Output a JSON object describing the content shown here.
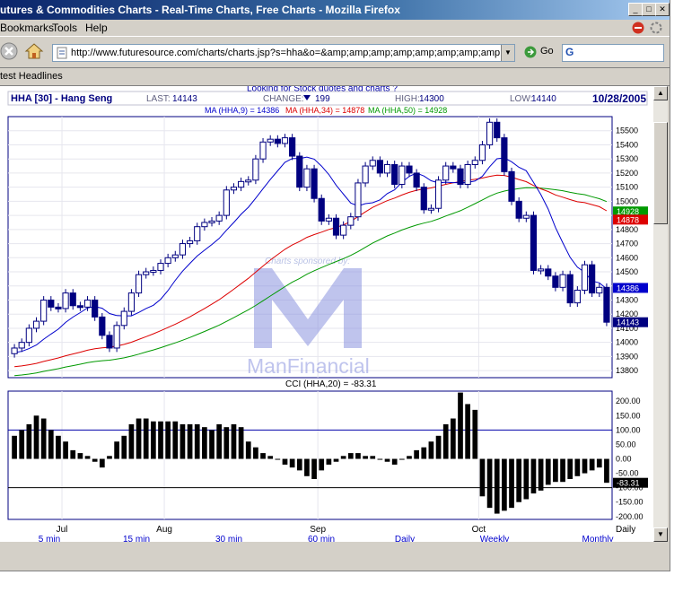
{
  "window": {
    "title": "utures & Commodities Charts - Real-Time Charts, Free Charts - Mozilla Firefox"
  },
  "menu": [
    "Bookmarks",
    "Tools",
    "Help"
  ],
  "address_bar": {
    "url": "http://www.futuresource.com/charts/charts.jsp?s=hha&o=&amp;amp;amp;amp;amp;amp;amp;amp;amp;a=D&",
    "go_label": "Go"
  },
  "bookmarks": {
    "item": "test Headlines"
  },
  "page": {
    "top_link": "Looking for Stock quotes and charts ?"
  },
  "header": {
    "symbol": "HHA [30] - Hang Seng",
    "last_label": "LAST:",
    "last_value": "14143",
    "change_label": "CHANGE:",
    "change_value": "199",
    "high_label": "HIGH:",
    "high_value": "14300",
    "low_label": "LOW:",
    "low_value": "14140",
    "date": "10/28/2005"
  },
  "ma_legend": {
    "ma9": "MA (HHA,9) = 14386",
    "ma34": "MA (HHA,34) = 14878",
    "ma50": "MA (HHA,50) = 14928"
  },
  "watermark": {
    "sponsor": "Charts sponsored by:",
    "brand": "ManFinancial"
  },
  "colors": {
    "ma9": "#0000cc",
    "ma34": "#dd0000",
    "ma50": "#009900",
    "candle": "#000080",
    "panel_border": "#000080"
  },
  "chart_data": [
    {
      "type": "candlestick",
      "title": "HHA [30] - Hang Seng",
      "ylim": [
        13750,
        15600
      ],
      "y_ticks": [
        13800,
        13900,
        14000,
        14100,
        14200,
        14300,
        14400,
        14500,
        14600,
        14700,
        14800,
        14900,
        15000,
        15100,
        15200,
        15300,
        15400,
        15500
      ],
      "x_labels": [
        "Jul",
        "Aug",
        "Sep",
        "Oct"
      ],
      "grid": true,
      "close": [
        13960,
        14000,
        14100,
        14150,
        14300,
        14250,
        14240,
        14350,
        14260,
        14250,
        14300,
        14180,
        14050,
        13960,
        14120,
        14220,
        14350,
        14480,
        14500,
        14510,
        14560,
        14600,
        14620,
        14700,
        14720,
        14820,
        14850,
        14860,
        14900,
        15080,
        15100,
        15140,
        15150,
        15300,
        15420,
        15440,
        15410,
        15450,
        15320,
        15100,
        15230,
        15020,
        14860,
        14880,
        14760,
        14830,
        14890,
        15130,
        15250,
        15290,
        15200,
        15260,
        15120,
        15250,
        15200,
        15100,
        14940,
        14950,
        15150,
        15250,
        15230,
        15120,
        15260,
        15290,
        15400,
        15560,
        15450,
        15210,
        15000,
        14880,
        14900,
        14510,
        14520,
        14470,
        14390,
        14480,
        14280,
        14370,
        14550,
        14350,
        14390,
        14143
      ],
      "ma_series": [
        {
          "name": "MA (HHA,9)",
          "value": 14386
        },
        {
          "name": "MA (HHA,34)",
          "value": 14878
        },
        {
          "name": "MA (HHA,50)",
          "value": 14928
        }
      ],
      "price_tags": [
        "14928",
        "14878",
        "14386",
        "14143"
      ]
    },
    {
      "type": "bar",
      "title": "CCI (HHA,20) = -83.31",
      "ylim": [
        -210,
        235
      ],
      "y_ticks": [
        200.0,
        150.0,
        100.0,
        50.0,
        0.0,
        -50.0,
        -100.0,
        -150.0,
        -200.0
      ],
      "y_tick_labels": [
        "200.00",
        "150.00",
        "100.00",
        "50.00",
        "0.00",
        "-50.00",
        "-100.00",
        "-150.00",
        "-200.00"
      ],
      "ref_lines": [
        100,
        -100
      ],
      "x_labels": [
        "Jul",
        "Aug",
        "Sep",
        "Oct",
        "Daily"
      ],
      "values": [
        80,
        100,
        120,
        150,
        140,
        100,
        80,
        60,
        30,
        20,
        10,
        -10,
        -30,
        10,
        60,
        80,
        120,
        140,
        140,
        130,
        130,
        130,
        130,
        120,
        120,
        120,
        110,
        100,
        120,
        110,
        120,
        110,
        60,
        40,
        20,
        10,
        0,
        -20,
        -30,
        -40,
        -60,
        -70,
        -40,
        -20,
        -10,
        10,
        20,
        20,
        10,
        10,
        0,
        -10,
        -20,
        0,
        10,
        30,
        40,
        60,
        80,
        120,
        140,
        230,
        190,
        170,
        -130,
        -170,
        -190,
        -180,
        -170,
        -150,
        -140,
        -120,
        -110,
        -90,
        -80,
        -80,
        -70,
        -60,
        -50,
        -40,
        -30,
        -83
      ],
      "last_label": "-83.31"
    }
  ],
  "bottom_tabs": [
    "5 min",
    "15 min",
    "30 min",
    "60 min",
    "Daily",
    "Weekly",
    "Monthly"
  ]
}
